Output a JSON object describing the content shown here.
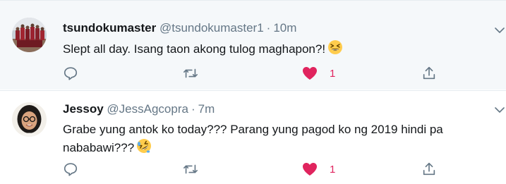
{
  "tweets": [
    {
      "name": "tsundokumaster",
      "handle": "@tsundokumaster1",
      "separator": "·",
      "time": "10m",
      "text": "Slept all day. Isang taon akong tulog maghapon?!",
      "emoji": "grinning-squinting-face",
      "avatar": "basketball-team-photo",
      "likes": "1",
      "liked": true
    },
    {
      "name": "Jessoy",
      "handle": "@JessAgcopra",
      "separator": "·",
      "time": "7m",
      "text": "Grabe yung antok ko today??? Parang yung pagod ko ng 2019 hindi pa nababawi???",
      "emoji": "rolling-on-the-floor-laughing",
      "avatar": "woman-with-glasses-photo",
      "likes": "1",
      "liked": true
    }
  ],
  "colors": {
    "like": "#e0245e",
    "icon": "#657786",
    "text": "#14171a",
    "highlight_bg": "#f5f8fa"
  },
  "icons": [
    "reply-icon",
    "retweet-icon",
    "heart-icon",
    "share-icon",
    "chevron-down-icon"
  ]
}
